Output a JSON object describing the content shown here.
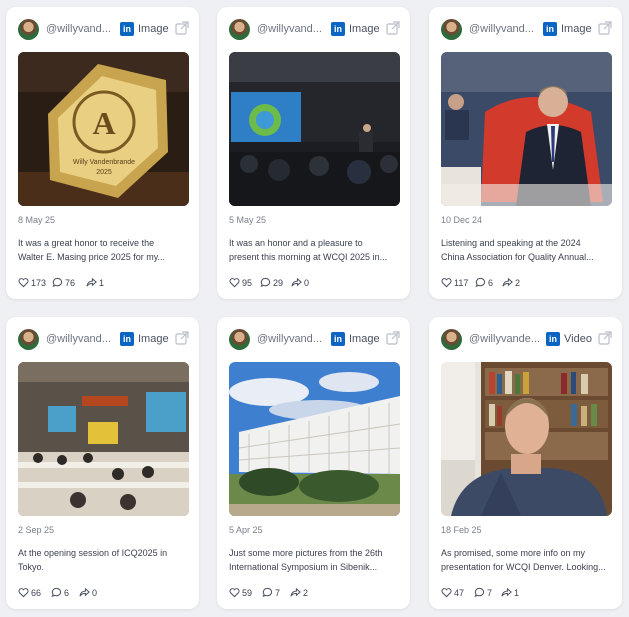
{
  "posts": [
    {
      "handle": "@willyvand...",
      "type": "Image",
      "date": "8 May 25",
      "text_line1": "It was a great honor to receive the",
      "text_line2": "Walter E. Masing price 2025 for my...",
      "likes": "173",
      "comments": "76",
      "shares": "1",
      "photo_text": {
        "line1": "Willy Vandenbrande",
        "line2": "2025"
      }
    },
    {
      "handle": "@willyvand...",
      "type": "Image",
      "date": "5 May 25",
      "text_line1": "It was an honor and a pleasure to",
      "text_line2": "present this morning at WCQI 2025 in...",
      "likes": "95",
      "comments": "29",
      "shares": "0"
    },
    {
      "handle": "@willyvand...",
      "type": "Image",
      "date": "10 Dec 24",
      "text_line1": "Listening and speaking at the 2024",
      "text_line2": "China Association for Quality Annual...",
      "likes": "117",
      "comments": "6",
      "shares": "2"
    },
    {
      "handle": "@willyvand...",
      "type": "Image",
      "date": "2 Sep 25",
      "text_line1": "At the opening session of ICQ2025 in",
      "text_line2": "Tokyo.",
      "likes": "66",
      "comments": "6",
      "shares": "0"
    },
    {
      "handle": "@willyvand...",
      "type": "Image",
      "date": "5 Apr 25",
      "text_line1": "Just some more pictures from the 26th",
      "text_line2": "International Symposium in Sibenik...",
      "likes": "59",
      "comments": "7",
      "shares": "2"
    },
    {
      "handle": "@willyvande...",
      "type": "Video",
      "date": "18 Feb 25",
      "text_line1": "As promised, some more info on my",
      "text_line2": "presentation for WCQI Denver. Looking...",
      "likes": "47",
      "comments": "7",
      "shares": "1"
    }
  ],
  "icons": {
    "linkedin": "linkedin-icon",
    "external": "external-link-icon",
    "like": "heart-icon",
    "comment": "comment-icon",
    "share": "share-icon"
  },
  "colors": {
    "linkedin": "#0a66c2",
    "background": "#eef0f3"
  }
}
